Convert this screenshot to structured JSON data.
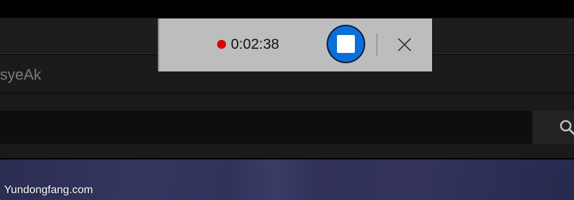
{
  "recorder": {
    "elapsed_time": "0:02:38",
    "recording_color": "#e00000",
    "stop_button_color": "#0a6fd8",
    "stop_icon": "stop-icon",
    "close_icon": "close-icon"
  },
  "channel": {
    "name": "syeAk"
  },
  "search": {
    "placeholder": "",
    "icon": "search-icon"
  },
  "watermark": {
    "text": "Yundongfang.com"
  }
}
